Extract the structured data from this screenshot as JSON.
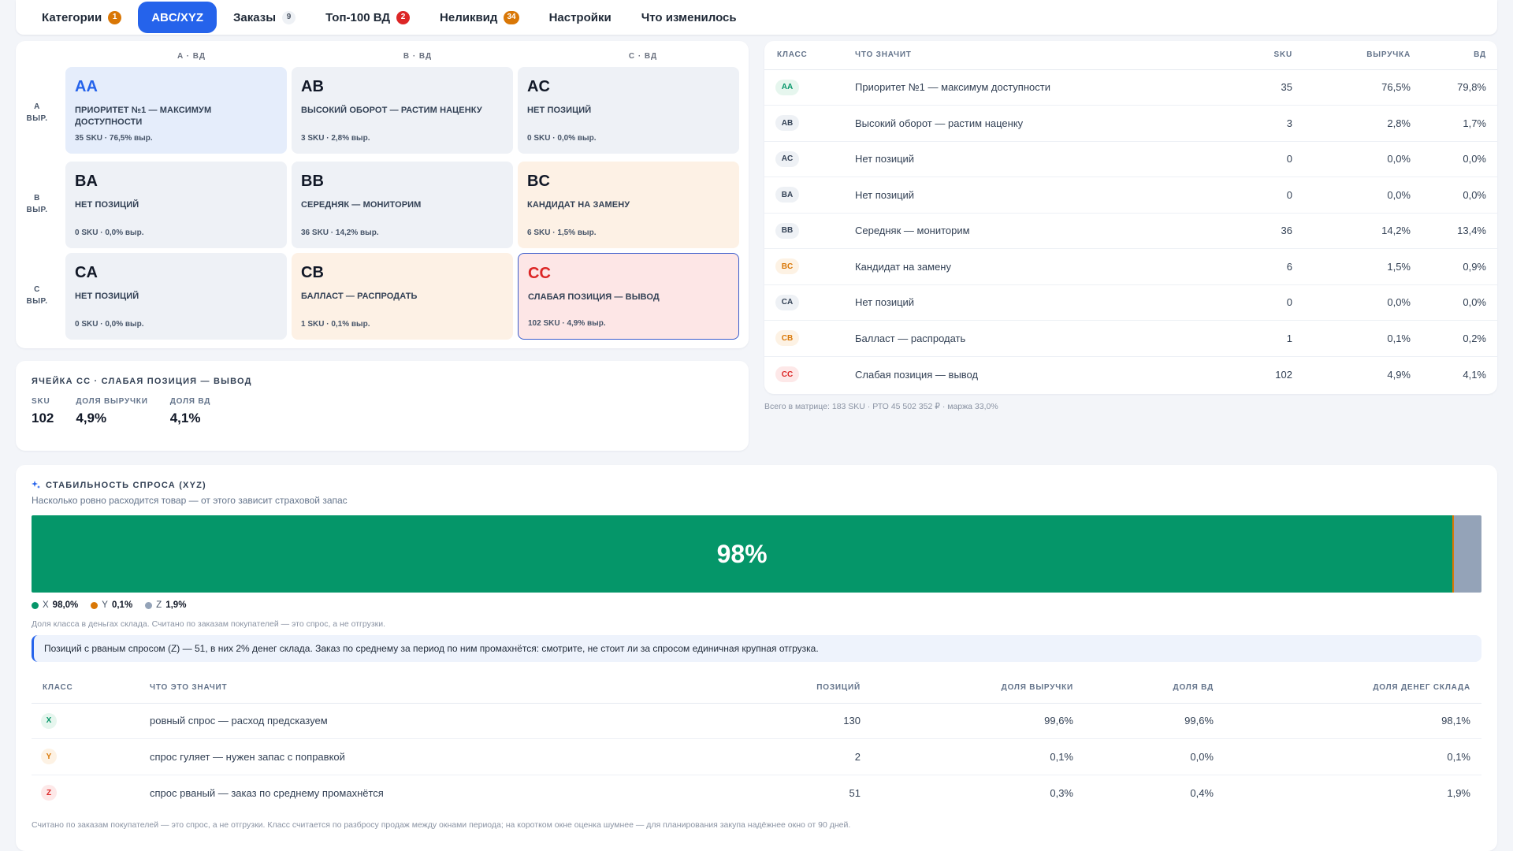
{
  "nav": {
    "tabs": [
      {
        "label": "Категории",
        "badge": "1",
        "badge_style": "orange",
        "active": false
      },
      {
        "label": "ABC/XYZ",
        "badge": "",
        "badge_style": "",
        "active": true
      },
      {
        "label": "Заказы",
        "badge": "9",
        "badge_style": "grey",
        "active": false
      },
      {
        "label": "Топ-100 ВД",
        "badge": "2",
        "badge_style": "red",
        "active": false
      },
      {
        "label": "Неликвид",
        "badge": "34",
        "badge_style": "orange",
        "active": false
      },
      {
        "label": "Настройки",
        "badge": "",
        "badge_style": "",
        "active": false
      },
      {
        "label": "Что изменилось",
        "badge": "",
        "badge_style": "",
        "active": false
      }
    ]
  },
  "matrix": {
    "col_headers": [
      "A · ВД",
      "B · ВД",
      "C · ВД"
    ],
    "row_headers": [
      {
        "line1": "A",
        "line2": "ВЫР."
      },
      {
        "line1": "B",
        "line2": "ВЫР."
      },
      {
        "line1": "C",
        "line2": "ВЫР."
      }
    ],
    "cells": [
      {
        "code": "AA",
        "desc": "ПРИОРИТЕТ №1 — МАКСИМУМ ДОСТУПНОСТИ",
        "stat": "35 SKU · 76,5% выр.",
        "tone": "blue"
      },
      {
        "code": "AB",
        "desc": "ВЫСОКИЙ ОБОРОТ — РАСТИМ НАЦЕНКУ",
        "stat": "3 SKU · 2,8% выр.",
        "tone": "grey"
      },
      {
        "code": "AC",
        "desc": "НЕТ ПОЗИЦИЙ",
        "stat": "0 SKU · 0,0% выр.",
        "tone": "grey"
      },
      {
        "code": "BA",
        "desc": "НЕТ ПОЗИЦИЙ",
        "stat": "0 SKU · 0,0% выр.",
        "tone": "grey"
      },
      {
        "code": "BB",
        "desc": "СЕРЕДНЯК — МОНИТОРИМ",
        "stat": "36 SKU · 14,2% выр.",
        "tone": "grey"
      },
      {
        "code": "BC",
        "desc": "КАНДИДАТ НА ЗАМЕНУ",
        "stat": "6 SKU · 1,5% выр.",
        "tone": "peach"
      },
      {
        "code": "CA",
        "desc": "НЕТ ПОЗИЦИЙ",
        "stat": "0 SKU · 0,0% выр.",
        "tone": "grey"
      },
      {
        "code": "CB",
        "desc": "БАЛЛАСТ — РАСПРОДАТЬ",
        "stat": "1 SKU · 0,1% выр.",
        "tone": "peach"
      },
      {
        "code": "CC",
        "desc": "СЛАБАЯ ПОЗИЦИЯ — ВЫВОД",
        "stat": "102 SKU · 4,9% выр.",
        "tone": "red"
      }
    ]
  },
  "class_table": {
    "headers": {
      "cls": "КЛАСС",
      "meaning": "ЧТО ЗНАЧИТ",
      "sku": "SKU",
      "revenue": "ВЫРУЧКА",
      "vd": "ВД"
    },
    "rows": [
      {
        "cls": "AA",
        "tone": "green",
        "meaning": "Приоритет №1 — максимум доступности",
        "sku": "35",
        "revenue": "76,5%",
        "vd": "79,8%"
      },
      {
        "cls": "AB",
        "tone": "grey",
        "meaning": "Высокий оборот — растим наценку",
        "sku": "3",
        "revenue": "2,8%",
        "vd": "1,7%"
      },
      {
        "cls": "AC",
        "tone": "grey",
        "meaning": "Нет позиций",
        "sku": "0",
        "revenue": "0,0%",
        "vd": "0,0%"
      },
      {
        "cls": "BA",
        "tone": "grey",
        "meaning": "Нет позиций",
        "sku": "0",
        "revenue": "0,0%",
        "vd": "0,0%"
      },
      {
        "cls": "BB",
        "tone": "grey",
        "meaning": "Середняк — мониторим",
        "sku": "36",
        "revenue": "14,2%",
        "vd": "13,4%"
      },
      {
        "cls": "BC",
        "tone": "orange",
        "meaning": "Кандидат на замену",
        "sku": "6",
        "revenue": "1,5%",
        "vd": "0,9%"
      },
      {
        "cls": "CA",
        "tone": "grey",
        "meaning": "Нет позиций",
        "sku": "0",
        "revenue": "0,0%",
        "vd": "0,0%"
      },
      {
        "cls": "CB",
        "tone": "orange",
        "meaning": "Балласт — распродать",
        "sku": "1",
        "revenue": "0,1%",
        "vd": "0,2%"
      },
      {
        "cls": "CC",
        "tone": "red",
        "meaning": "Слабая позиция — вывод",
        "sku": "102",
        "revenue": "4,9%",
        "vd": "4,1%"
      }
    ],
    "footnote": "Всего в матрице: 183 SKU · РТО 45 502 352 ₽ · маржа 33,0%"
  },
  "selected_cell": {
    "title": "ЯЧЕЙКА CC · СЛАБАЯ ПОЗИЦИЯ — ВЫВОД",
    "kpis": [
      {
        "label": "SKU",
        "value": "102"
      },
      {
        "label": "ДОЛЯ ВЫРУЧКИ",
        "value": "4,9%"
      },
      {
        "label": "ДОЛЯ ВД",
        "value": "4,1%"
      }
    ]
  },
  "xyz": {
    "title": "СТАБИЛЬНОСТЬ СПРОСА (XYZ)",
    "icon": "sparkle-icon",
    "subtitle": "Насколько ровно расходится товар — от этого зависит страховой запас",
    "bar": {
      "label": "98%",
      "segments": [
        {
          "name": "X",
          "share": 98.0,
          "color": "#059669"
        },
        {
          "name": "Y",
          "share": 0.1,
          "color": "#d97706"
        },
        {
          "name": "Z",
          "share": 1.9,
          "color": "#94a3b8"
        }
      ]
    },
    "legend": [
      {
        "name": "X",
        "value": "98,0%",
        "color": "#059669"
      },
      {
        "name": "Y",
        "value": "0,1%",
        "color": "#d97706"
      },
      {
        "name": "Z",
        "value": "1,9%",
        "color": "#94a3b8"
      }
    ],
    "note": "Доля класса в деньгах склада. Считано по заказам покупателей — это спрос, а не отгрузки.",
    "callout": "Позиций с рваным спросом (Z) — 51, в них 2% денег склада. Заказ по среднему за период по ним промахнётся: смотрите, не стоит ли за спросом единичная крупная отгрузка.",
    "table": {
      "headers": {
        "cls": "КЛАСС",
        "meaning": "ЧТО ЭТО ЗНАЧИТ",
        "positions": "ПОЗИЦИЙ",
        "revenue": "ДОЛЯ ВЫРУЧКИ",
        "vd": "ДОЛЯ ВД",
        "money": "ДОЛЯ ДЕНЕГ СКЛАДА"
      },
      "rows": [
        {
          "cls": "X",
          "tone": "green",
          "meaning": "ровный спрос — расход предсказуем",
          "positions": "130",
          "revenue": "99,6%",
          "vd": "99,6%",
          "money": "98,1%"
        },
        {
          "cls": "Y",
          "tone": "orange",
          "meaning": "спрос гуляет — нужен запас с поправкой",
          "positions": "2",
          "revenue": "0,1%",
          "vd": "0,0%",
          "money": "0,1%"
        },
        {
          "cls": "Z",
          "tone": "red",
          "meaning": "спрос рваный — заказ по среднему промахнётся",
          "positions": "51",
          "revenue": "0,3%",
          "vd": "0,4%",
          "money": "1,9%"
        }
      ]
    },
    "bottom_note": "Считано по заказам покупателей — это спрос, а не отгрузки. Класс считается по разбросу продаж между окнами периода; на коротком окне оценка шумнее — для планирования закупа надёжнее окно от 90 дней."
  }
}
